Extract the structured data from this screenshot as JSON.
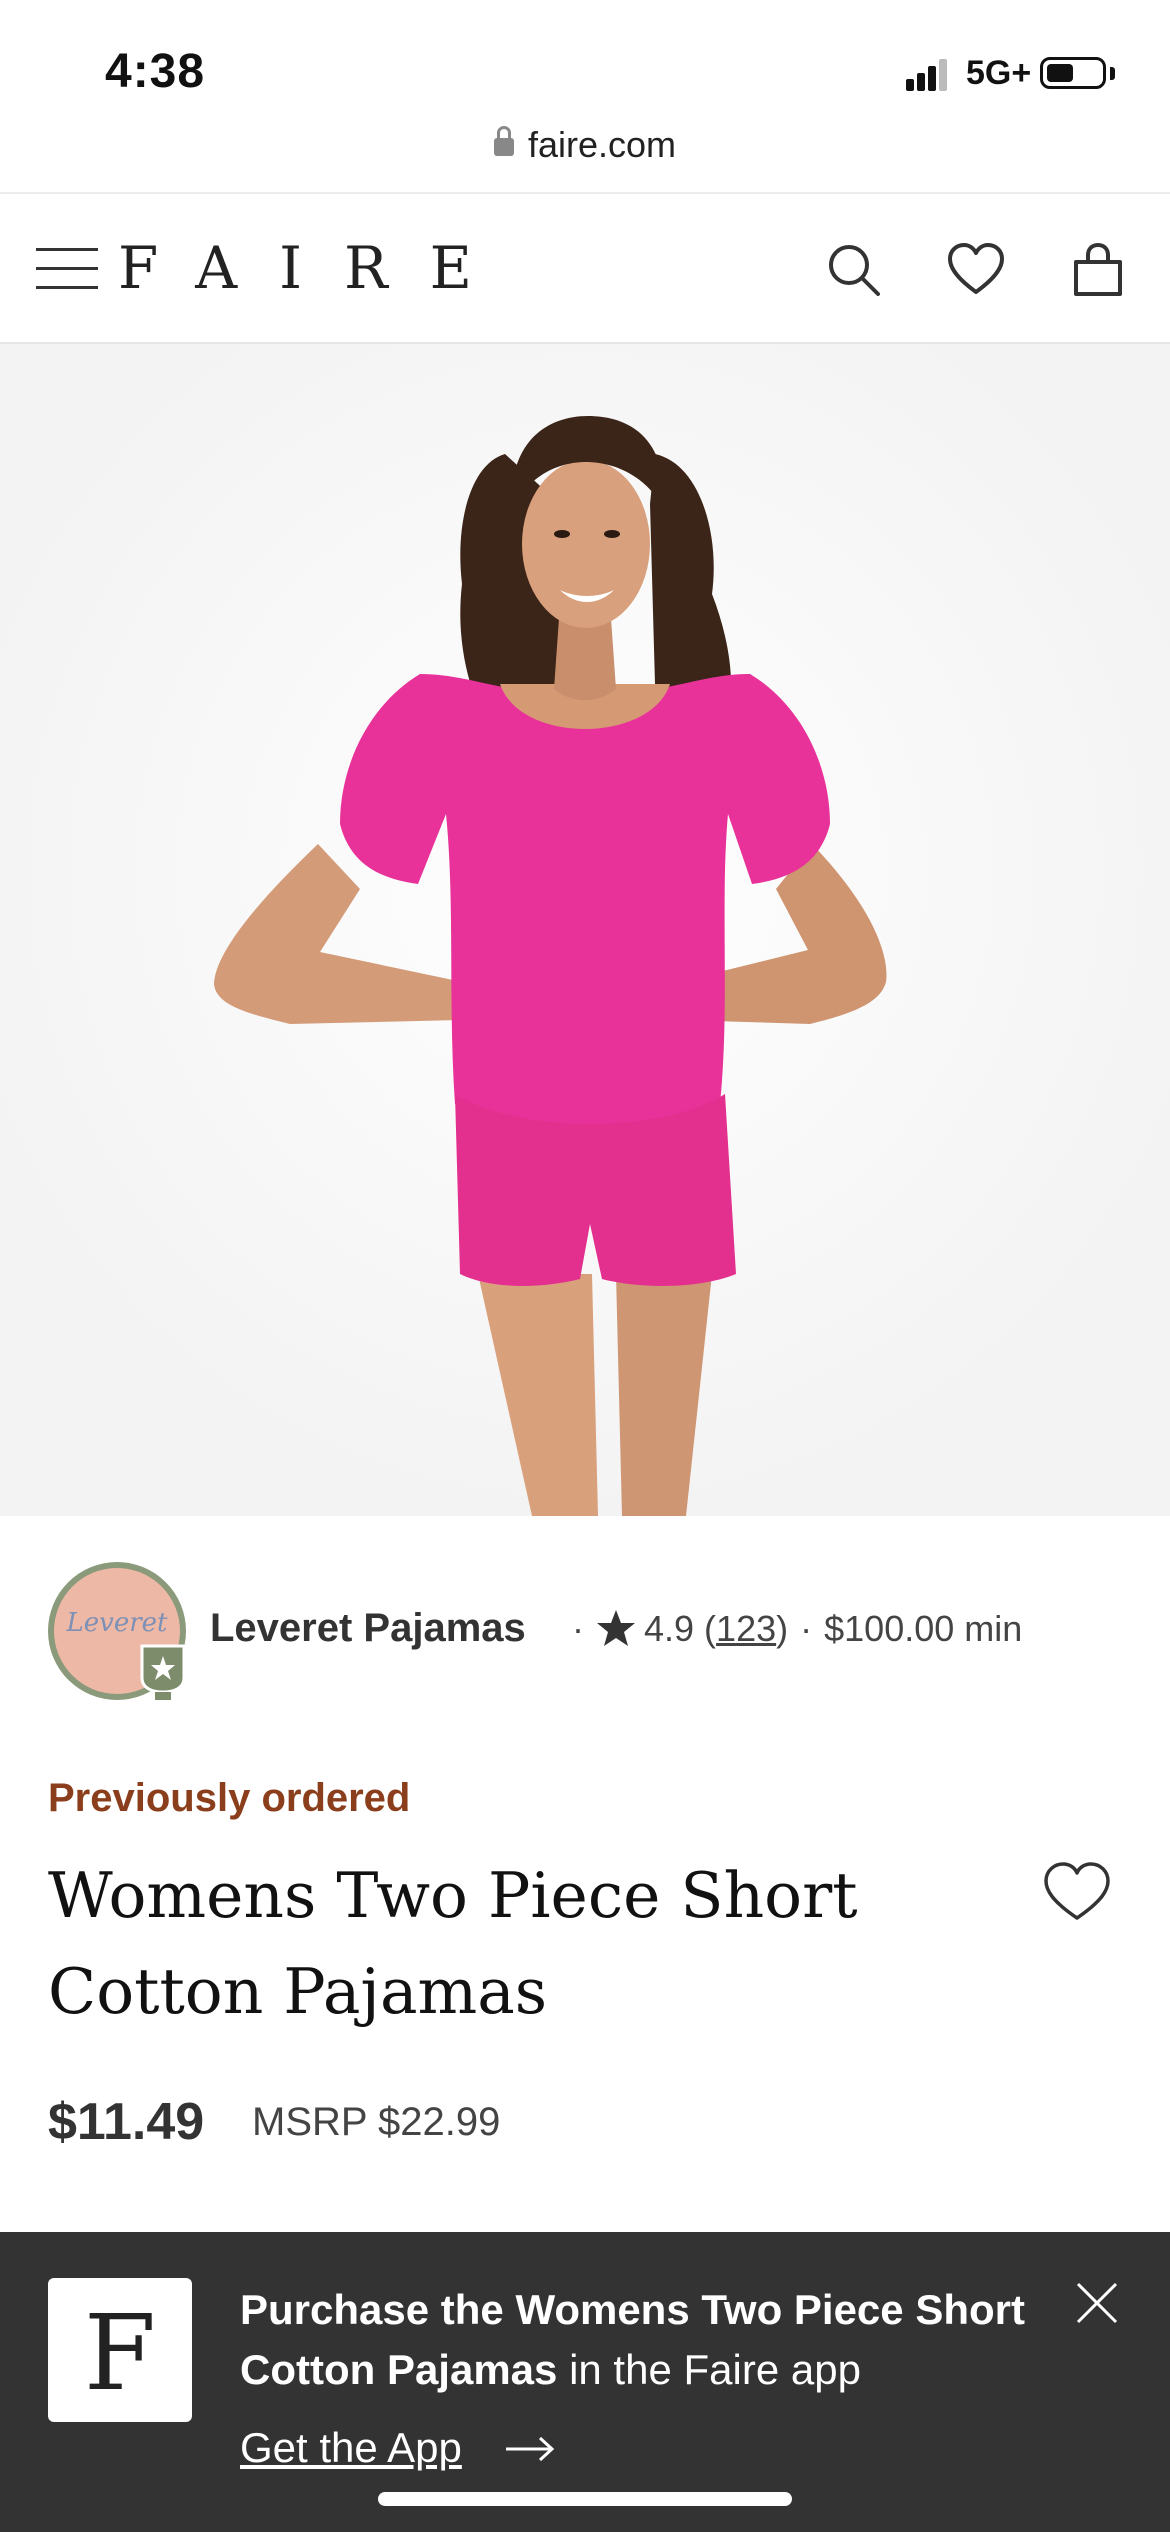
{
  "status_bar": {
    "time": "4:38",
    "network": "5G+"
  },
  "browser": {
    "url": "faire.com"
  },
  "header": {
    "logo": "FAIRE"
  },
  "brand": {
    "avatar_text": "Leveret",
    "name": "Leveret Pajamas",
    "separator": "·",
    "rating": "4.9",
    "review_count": "123",
    "minimum": "$100.00 min"
  },
  "product": {
    "badge": "Previously ordered",
    "title": "Womens Two Piece Short Cotton Pajamas",
    "price": "$11.49",
    "msrp_label": "MSRP",
    "msrp": "$22.99",
    "color": "#e8329a"
  },
  "app_banner": {
    "logo_letter": "F",
    "text_bold": "Purchase the Womens Two Piece Short Cotton Pajamas",
    "text_regular": " in the Faire app",
    "cta": "Get the App"
  },
  "colors": {
    "accent_previously_ordered": "#8b3e1b",
    "banner_bg": "#333333",
    "hero_bg": "#f5f5f5"
  },
  "icons": [
    "lock-icon",
    "menu-icon",
    "search-icon",
    "heart-icon",
    "bag-icon",
    "star-icon",
    "close-icon",
    "arrow-right-icon"
  ]
}
